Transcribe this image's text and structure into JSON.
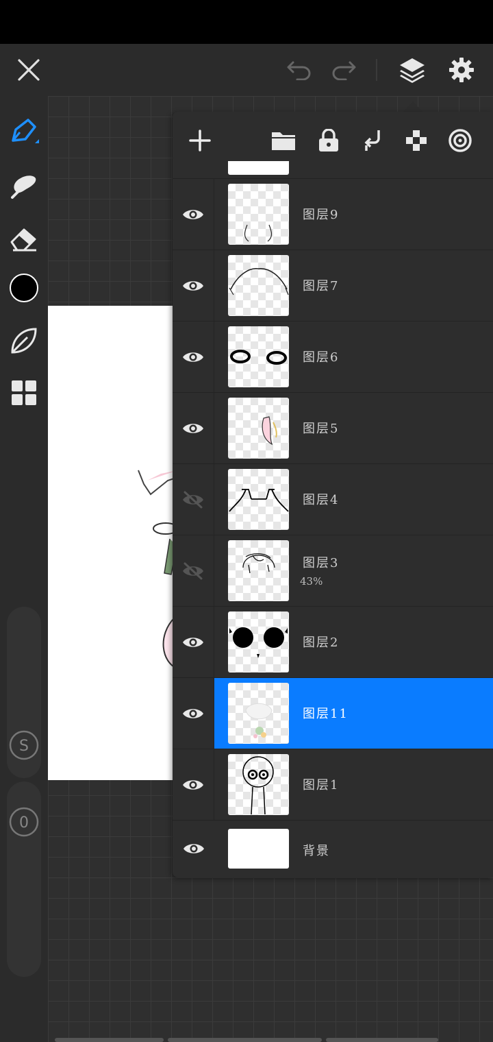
{
  "toolbar_top": {
    "close_icon": "close-icon",
    "undo_icon": "undo-icon",
    "redo_icon": "redo-icon",
    "layers_icon": "layers-icon",
    "settings_icon": "gear-icon"
  },
  "left_tools": {
    "items": [
      "pen-icon",
      "smudge-icon",
      "eraser-icon",
      "color-swatch",
      "leaf-icon",
      "grid-icon"
    ],
    "current_color": "#000000",
    "brush_size_label": "S",
    "opacity_value": "0"
  },
  "layers_panel": {
    "header_icons": [
      "add-layer-icon",
      "folder-icon",
      "lock-icon",
      "merge-down-icon",
      "checker-icon",
      "target-icon"
    ],
    "layers": [
      {
        "name": "图层9",
        "visible": true,
        "opacity": "",
        "selected": false
      },
      {
        "name": "图层7",
        "visible": true,
        "opacity": "",
        "selected": false
      },
      {
        "name": "图层6",
        "visible": true,
        "opacity": "",
        "selected": false
      },
      {
        "name": "图层5",
        "visible": true,
        "opacity": "",
        "selected": false
      },
      {
        "name": "图层4",
        "visible": false,
        "opacity": "",
        "selected": false
      },
      {
        "name": "图层3",
        "visible": false,
        "opacity": "43%",
        "selected": false
      },
      {
        "name": "图层2",
        "visible": true,
        "opacity": "",
        "selected": false
      },
      {
        "name": "图层11",
        "visible": true,
        "opacity": "",
        "selected": true
      },
      {
        "name": "图层1",
        "visible": true,
        "opacity": "",
        "selected": false
      }
    ],
    "background_layer": {
      "name": "背景",
      "visible": true
    },
    "selected_color": "#0a7cff"
  }
}
